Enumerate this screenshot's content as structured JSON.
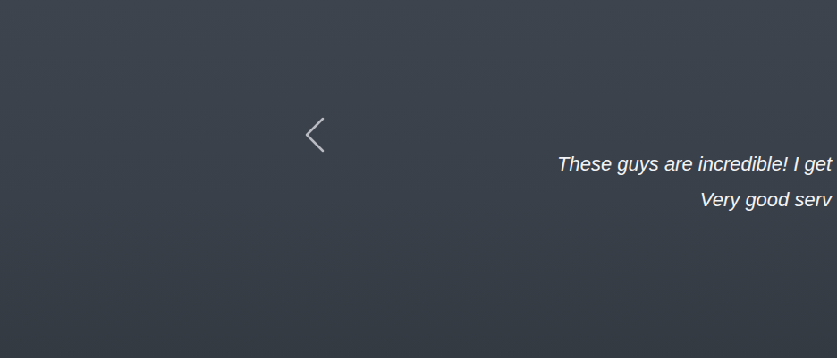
{
  "testimonial": {
    "lines": [
      "These guys are incredible! I get",
      "Very good serv"
    ]
  }
}
